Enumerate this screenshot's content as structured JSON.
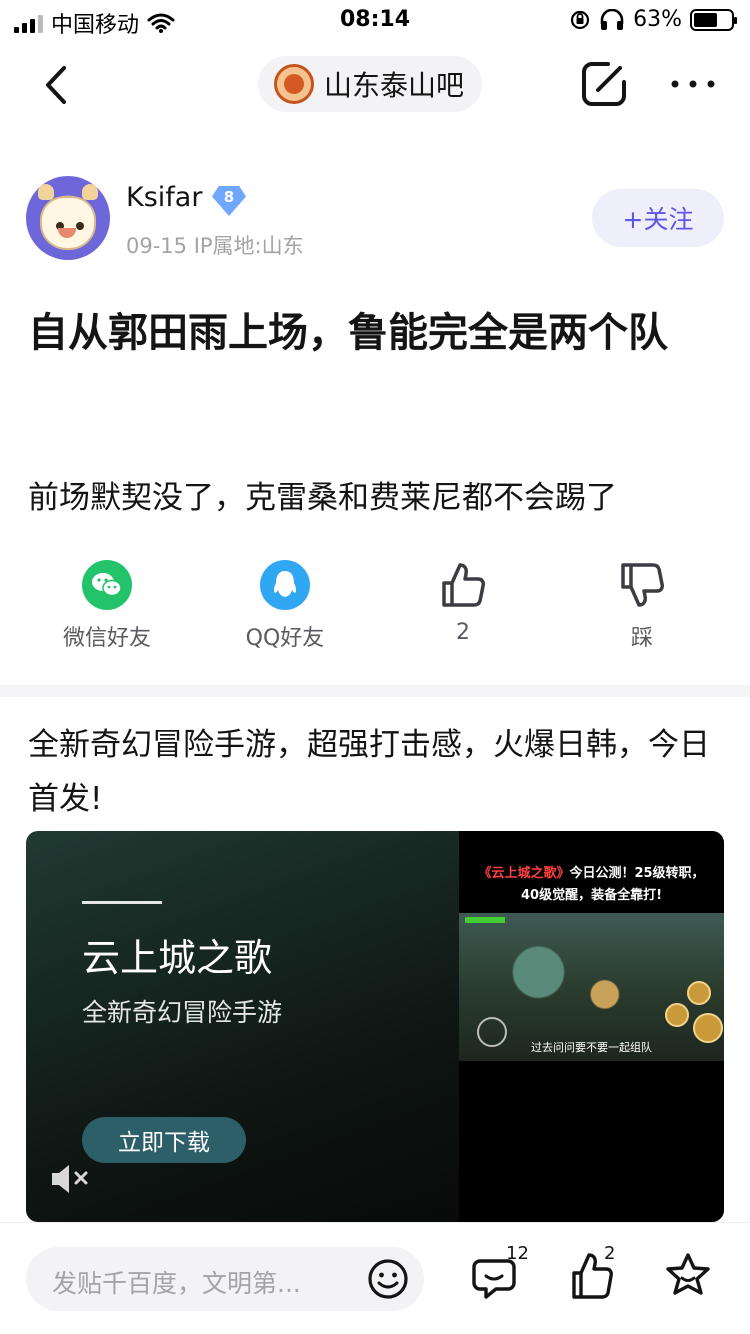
{
  "status_bar": {
    "carrier": "中国移动",
    "time": "08:14",
    "battery_pct": "63%"
  },
  "nav": {
    "forum_name": "山东泰山吧"
  },
  "author": {
    "name": "Ksifar",
    "level": "8",
    "meta": "09-15  IP属地:山东",
    "follow_label": "+关注"
  },
  "post": {
    "title": "自从郭田雨上场，鲁能完全是两个队",
    "body": "前场默契没了，克雷桑和费莱尼都不会踢了"
  },
  "share": {
    "wechat_label": "微信好友",
    "qq_label": "QQ好友",
    "like_count": "2",
    "dislike_label": "踩"
  },
  "ad": {
    "title": "全新奇幻冒险手游，超强打击感，火爆日韩，今日首发!",
    "game_name": "云上城之歌",
    "subtitle": "全新奇幻冒险手游",
    "download_label": "立即下载",
    "caption_highlight": "《云上城之歌》",
    "caption_rest": "今日公测！25级转职，",
    "caption_line2": "40级觉醒，装备全靠打!",
    "shot_caption": "过去问问要不要一起组队"
  },
  "bottom_bar": {
    "input_placeholder": "发贴千百度，文明第...",
    "comment_count": "12",
    "like_count": "2"
  },
  "colors": {
    "accent": "#5f55e6",
    "wechat": "#22c36b",
    "qq": "#2fa7f3"
  }
}
